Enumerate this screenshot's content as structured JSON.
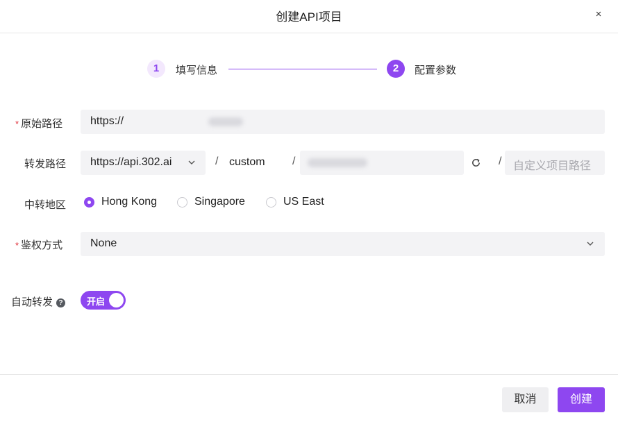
{
  "dialog": {
    "title": "创建API项目",
    "close_icon": "×"
  },
  "steps": [
    {
      "number": "1",
      "label": "填写信息",
      "state": "done"
    },
    {
      "number": "2",
      "label": "配置参数",
      "state": "active"
    }
  ],
  "form": {
    "origin_path": {
      "required_mark": "*",
      "label": "原始路径",
      "value": "https://"
    },
    "forward_path": {
      "label": "转发路径",
      "domain": "https://api.302.ai",
      "separator": "/",
      "segment": "custom",
      "placeholder": "自定义项目路径"
    },
    "region": {
      "label": "中转地区",
      "options": [
        {
          "label": "Hong Kong",
          "selected": true
        },
        {
          "label": "Singapore",
          "selected": false
        },
        {
          "label": "US East",
          "selected": false
        }
      ]
    },
    "auth": {
      "required_mark": "*",
      "label": "鉴权方式",
      "value": "None"
    },
    "auto_forward": {
      "label": "自动转发",
      "help_icon": "?",
      "toggle_label": "开启",
      "enabled": true
    }
  },
  "footer": {
    "cancel_label": "取消",
    "create_label": "创建"
  },
  "colors": {
    "accent": "#8e47f0",
    "required": "#e0353e",
    "field_bg": "#f3f3f5"
  }
}
